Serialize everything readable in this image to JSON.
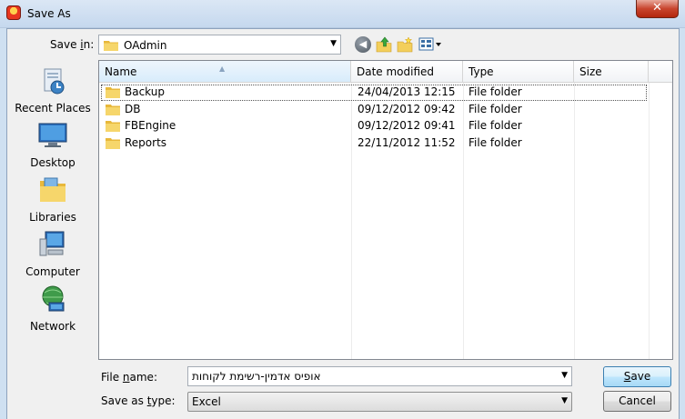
{
  "window": {
    "title": "Save As",
    "close_glyph": "✕"
  },
  "toolbar": {
    "save_in_label": "Save in:",
    "save_in_value": "OAdmin",
    "icons": [
      "back-icon",
      "up-folder-icon",
      "new-folder-icon",
      "view-menu-icon"
    ]
  },
  "places": [
    {
      "label": "Recent Places",
      "icon": "recent-places-icon"
    },
    {
      "label": "Desktop",
      "icon": "desktop-icon"
    },
    {
      "label": "Libraries",
      "icon": "libraries-icon"
    },
    {
      "label": "Computer",
      "icon": "computer-icon"
    },
    {
      "label": "Network",
      "icon": "network-icon"
    }
  ],
  "list": {
    "columns": [
      "Name",
      "Date modified",
      "Type",
      "Size"
    ],
    "sorted_column": "Name",
    "rows": [
      {
        "name": "Backup",
        "date": "24/04/2013 12:15",
        "type": "File folder",
        "size": ""
      },
      {
        "name": "DB",
        "date": "09/12/2012 09:42",
        "type": "File folder",
        "size": ""
      },
      {
        "name": "FBEngine",
        "date": "09/12/2012 09:41",
        "type": "File folder",
        "size": ""
      },
      {
        "name": "Reports",
        "date": "22/11/2012 11:52",
        "type": "File folder",
        "size": ""
      }
    ]
  },
  "footer": {
    "file_name_label": "File name:",
    "file_name_value": "אופיס אדמין-רשימת לקוחות",
    "save_type_label": "Save as type:",
    "save_type_value": "Excel",
    "save_button": "Save",
    "cancel_button": "Cancel"
  },
  "colors": {
    "title_bar": "#cfe0f1",
    "close_button": "#c8452e",
    "folder": "#f3cf5b",
    "default_button_border": "#3c7fb1"
  }
}
